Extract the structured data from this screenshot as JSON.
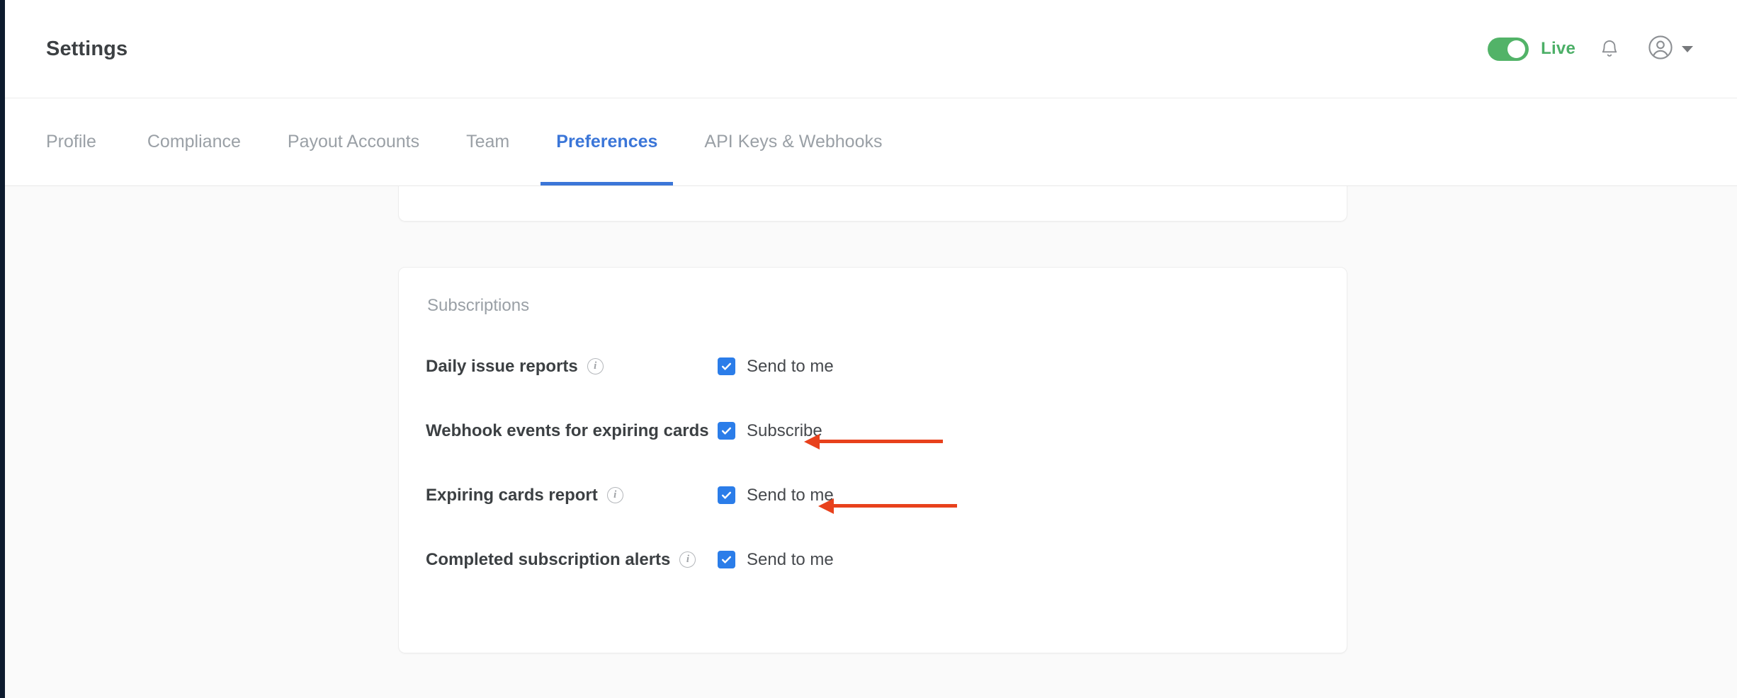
{
  "header": {
    "title": "Settings",
    "mode_toggle": {
      "state": "on",
      "label": "Live",
      "color": "#4caf67"
    },
    "notifications_icon": "bell-icon",
    "account_icon": "user-avatar-icon",
    "account_caret_icon": "chevron-down-icon"
  },
  "tabs": [
    {
      "label": "Profile",
      "active": false
    },
    {
      "label": "Compliance",
      "active": false
    },
    {
      "label": "Payout Accounts",
      "active": false
    },
    {
      "label": "Team",
      "active": false
    },
    {
      "label": "Preferences",
      "active": true
    },
    {
      "label": "API Keys & Webhooks",
      "active": false
    }
  ],
  "accent_color": "#3b76d8",
  "annotation_color": "#e8411c",
  "subscriptions": {
    "section_title": "Subscriptions",
    "rows": [
      {
        "label": "Daily issue reports",
        "info_icon": "info-icon",
        "checkbox_checked": true,
        "checkbox_label": "Send to me",
        "annotated": false
      },
      {
        "label": "Webhook events for expiring cards",
        "info_icon": "info-icon",
        "checkbox_checked": true,
        "checkbox_label": "Subscribe",
        "annotated": true
      },
      {
        "label": "Expiring cards report",
        "info_icon": "info-icon",
        "checkbox_checked": true,
        "checkbox_label": "Send to me",
        "annotated": true
      },
      {
        "label": "Completed subscription alerts",
        "info_icon": "info-icon",
        "checkbox_checked": true,
        "checkbox_label": "Send to me",
        "annotated": false
      }
    ]
  }
}
